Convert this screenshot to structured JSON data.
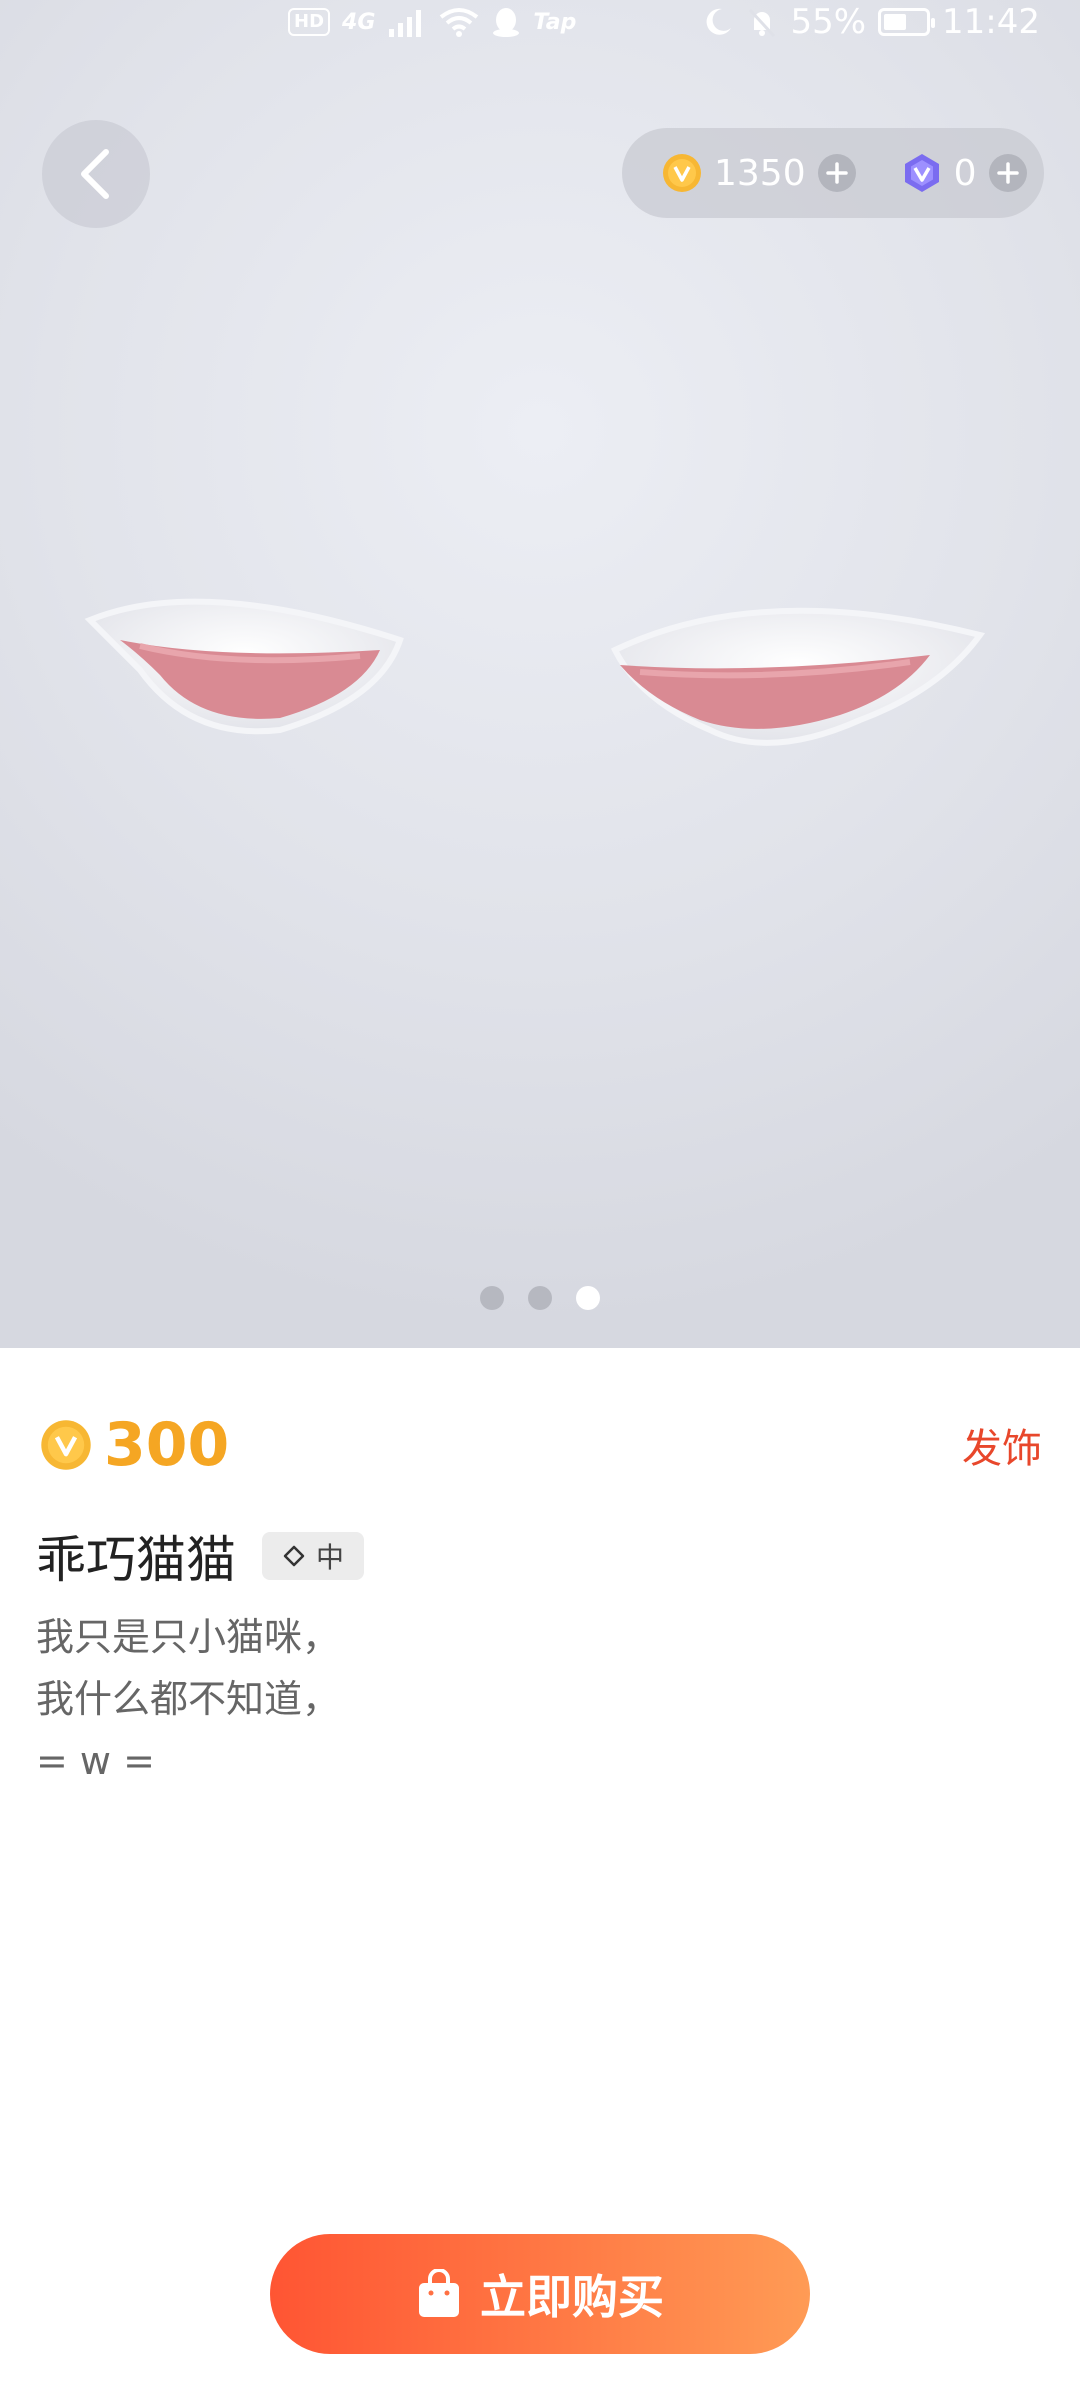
{
  "status_bar": {
    "hd_badge": "HD",
    "network": "4G",
    "app_hint": "Tap",
    "battery": "55%",
    "battery_level": 0.55,
    "time": "11:42"
  },
  "header": {
    "coins": "1350",
    "gems": "0"
  },
  "carousel": {
    "page_count": 3,
    "active_index": 2
  },
  "item": {
    "price": "300",
    "category": "发饰",
    "name": "乖巧猫猫",
    "rarity": "中",
    "description": [
      "我只是只小猫咪，",
      "我什么都不知道，",
      "= w ="
    ]
  },
  "actions": {
    "buy_label": "立即购买"
  },
  "colors": {
    "price": "#f5a623",
    "category": "#e8472b",
    "buy_start": "#ff5533",
    "buy_end": "#ff9b55",
    "gem": "#7b6cf0"
  },
  "icons": {
    "back": "chevron-left-icon",
    "coin": "coin-icon",
    "gem": "gem-icon",
    "add": "plus-icon",
    "rarity": "diamond-outline-icon",
    "buy": "shopping-bag-icon"
  }
}
